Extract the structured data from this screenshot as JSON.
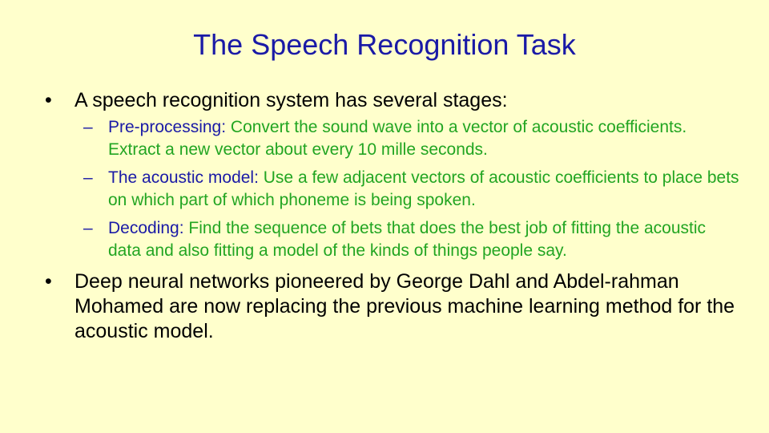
{
  "slide": {
    "title": "The Speech Recognition Task",
    "bullets": [
      {
        "mark": "•",
        "text": "A speech recognition system has several stages:"
      },
      {
        "mark": "•",
        "text": "Deep neural networks pioneered by George Dahl and Abdel-rahman Mohamed are now replacing the previous machine learning method for the acoustic model."
      }
    ],
    "sub_items": [
      {
        "dash": "–",
        "term": "Pre-processing",
        "sep": ": ",
        "desc": "Convert the sound wave into a vector of acoustic coefficients. Extract a new vector about every 10 mille seconds."
      },
      {
        "dash": "–",
        "term": "The acoustic model",
        "sep": ": ",
        "desc": "Use a few adjacent vectors of acoustic coefficients to place bets on which part of which phoneme is being spoken."
      },
      {
        "dash": "–",
        "term": "Decoding",
        "sep": ": ",
        "desc": "Find the sequence of bets that does the best job of fitting the acoustic data and also fitting a model of the kinds of things people say."
      }
    ],
    "colors": {
      "background": "#ffffcc",
      "title": "#1a1aa6",
      "term": "#1a1aa6",
      "description": "#22a522",
      "body": "#000000"
    }
  }
}
